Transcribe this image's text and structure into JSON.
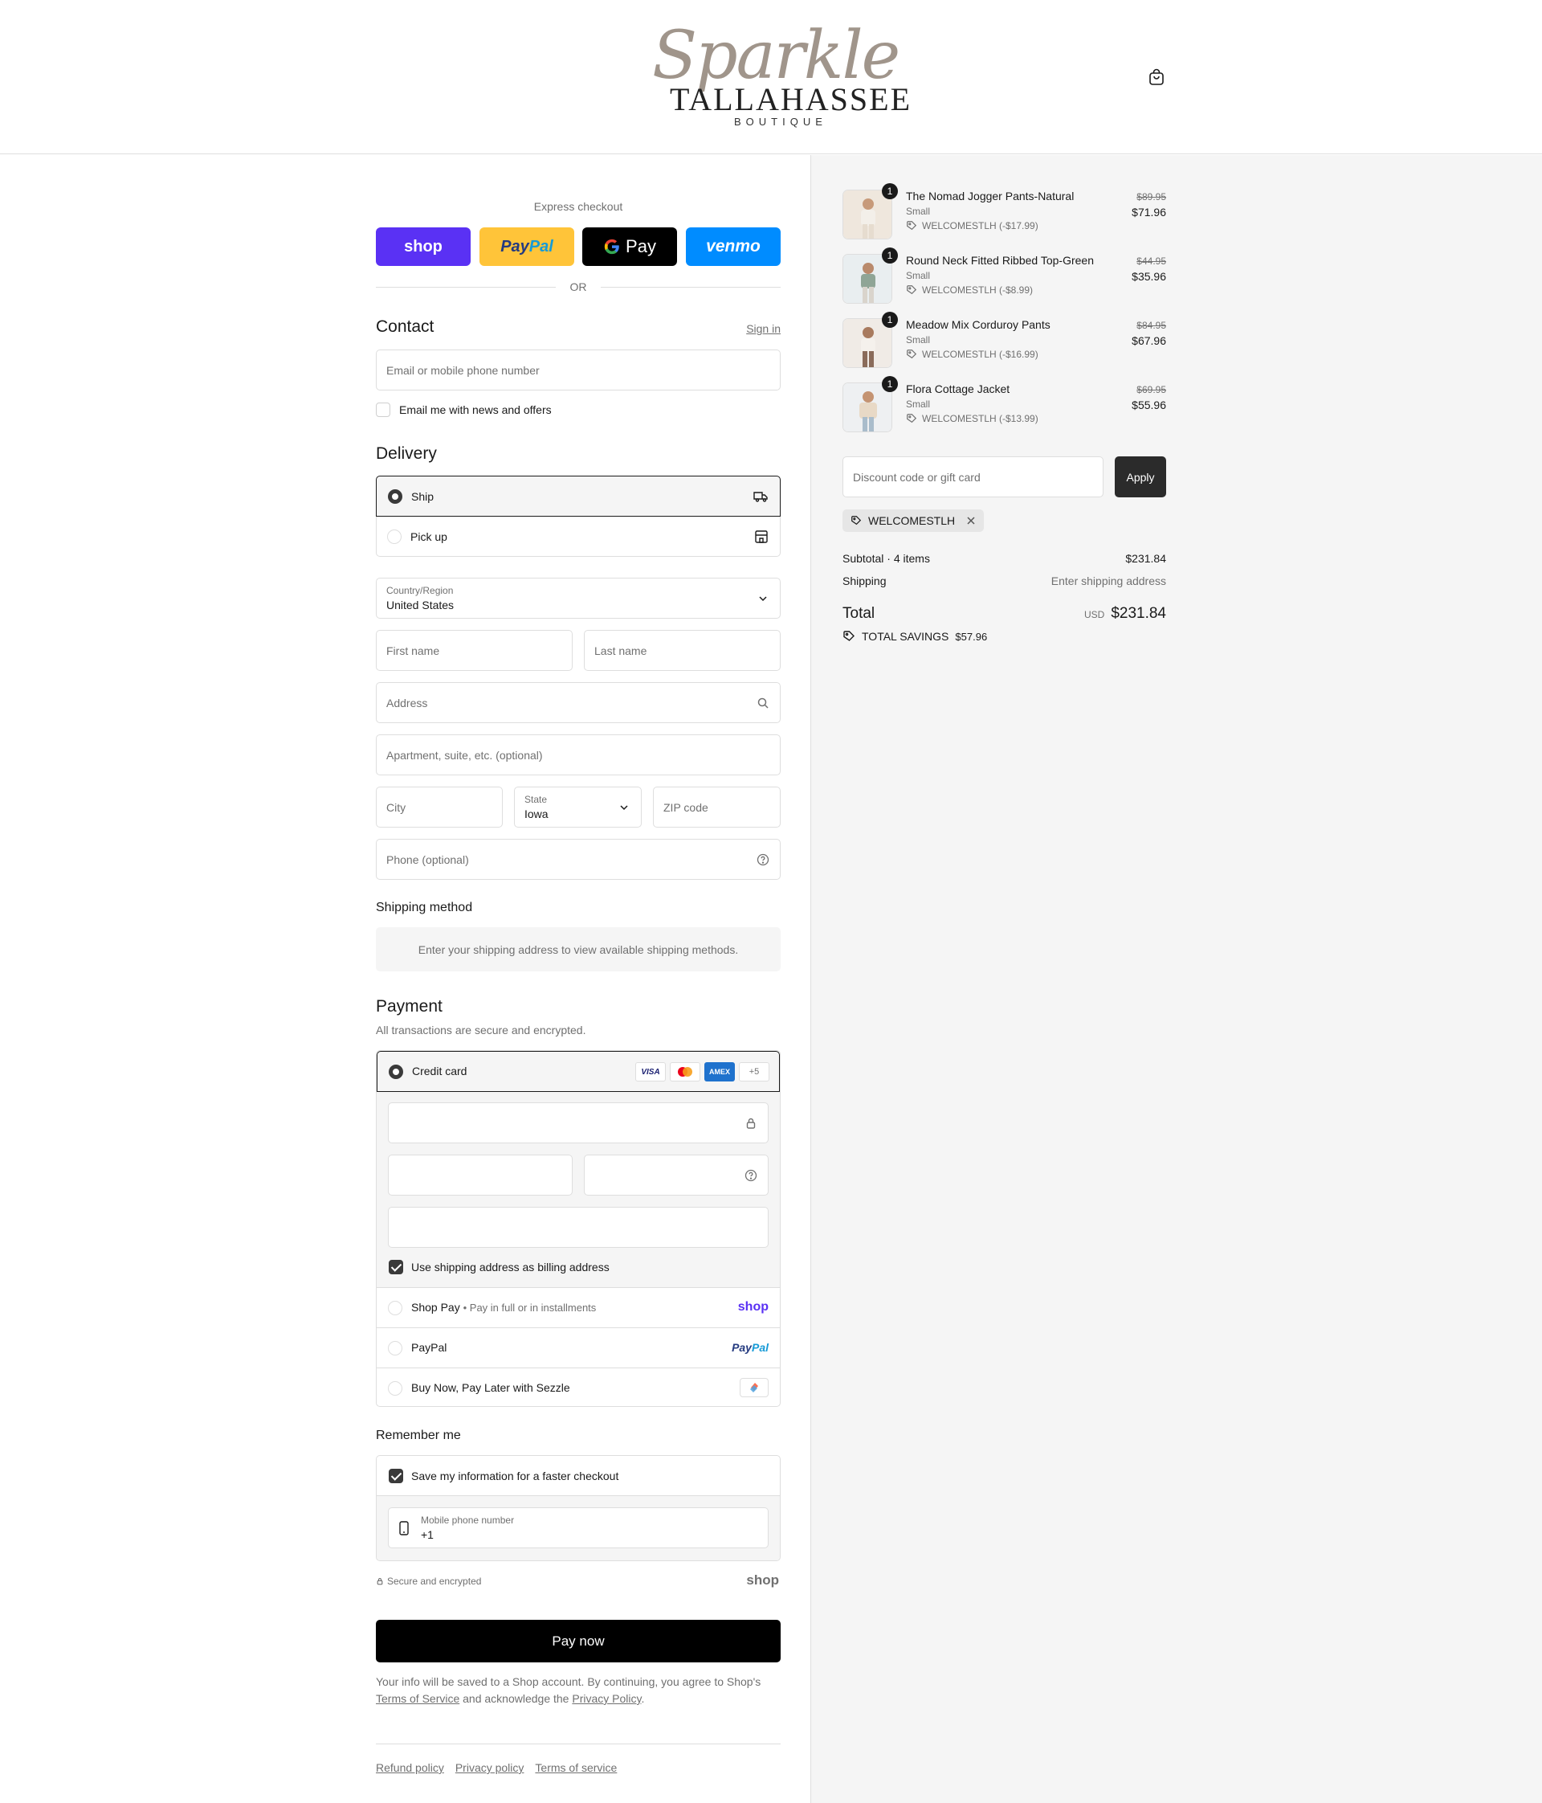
{
  "brand": {
    "script": "Sparkle",
    "main": "TALLAHASSEE",
    "sub": "BOUTIQUE"
  },
  "express": {
    "label": "Express checkout",
    "shop": "shop",
    "paypal_a": "Pay",
    "paypal_b": "Pal",
    "gpay": "Pay",
    "venmo": "venmo",
    "or": "OR"
  },
  "contact": {
    "title": "Contact",
    "sign_in": "Sign in",
    "email_placeholder": "Email or mobile phone number",
    "news_label": "Email me with news and offers"
  },
  "delivery": {
    "title": "Delivery",
    "ship": "Ship",
    "pickup": "Pick up",
    "country_label": "Country/Region",
    "country_value": "United States",
    "first_name": "First name",
    "last_name": "Last name",
    "address": "Address",
    "apartment": "Apartment, suite, etc. (optional)",
    "city": "City",
    "state_label": "State",
    "state_value": "Iowa",
    "zip": "ZIP code",
    "phone": "Phone (optional)"
  },
  "shipping_method": {
    "title": "Shipping method",
    "note": "Enter your shipping address to view available shipping methods."
  },
  "payment": {
    "title": "Payment",
    "subtitle": "All transactions are secure and encrypted.",
    "credit_card": "Credit card",
    "cards": [
      "VISA",
      "",
      "AMEX",
      "+5"
    ],
    "billing_same": "Use shipping address as billing address",
    "shop_pay": "Shop Pay",
    "shop_pay_note": "Pay in full or in installments",
    "shop_logo": "shop",
    "paypal": "PayPal",
    "paypal_logo_a": "Pay",
    "paypal_logo_b": "Pal",
    "sezzle": "Buy Now, Pay Later with Sezzle"
  },
  "remember": {
    "title": "Remember me",
    "save_label": "Save my information for a faster checkout",
    "phone_label": "Mobile phone number",
    "phone_value": "+1",
    "secure": "Secure and encrypted",
    "shop_logo": "shop"
  },
  "pay_now": "Pay now",
  "legal": {
    "text_a": "Your info will be saved to a Shop account. By continuing, you agree to Shop's",
    "terms": "Terms of Service",
    "text_b": "and acknowledge the",
    "privacy": "Privacy Policy",
    "text_c": "."
  },
  "footer": {
    "refund": "Refund policy",
    "privacy": "Privacy policy",
    "terms": "Terms of service"
  },
  "items": [
    {
      "name": "The Nomad Jogger Pants-Natural",
      "variant": "Small",
      "discount": "WELCOMESTLH (-$17.99)",
      "old_price": "$89.95",
      "price": "$71.96",
      "qty": "1"
    },
    {
      "name": "Round Neck Fitted Ribbed Top-Green",
      "variant": "Small",
      "discount": "WELCOMESTLH (-$8.99)",
      "old_price": "$44.95",
      "price": "$35.96",
      "qty": "1"
    },
    {
      "name": "Meadow Mix Corduroy Pants",
      "variant": "Small",
      "discount": "WELCOMESTLH (-$16.99)",
      "old_price": "$84.95",
      "price": "$67.96",
      "qty": "1"
    },
    {
      "name": "Flora Cottage Jacket",
      "variant": "Small",
      "discount": "WELCOMESTLH (-$13.99)",
      "old_price": "$69.95",
      "price": "$55.96",
      "qty": "1"
    }
  ],
  "summary": {
    "discount_placeholder": "Discount code or gift card",
    "apply": "Apply",
    "code_tag": "WELCOMESTLH",
    "subtotal_label": "Subtotal · 4 items",
    "subtotal_value": "$231.84",
    "shipping_label": "Shipping",
    "shipping_value": "Enter shipping address",
    "total_label": "Total",
    "currency": "USD",
    "total_value": "$231.84",
    "savings_label": "TOTAL SAVINGS",
    "savings_value": "$57.96"
  },
  "colors": {
    "shop": "#5a31f4",
    "paypal_yellow": "#ffc439",
    "venmo": "#008cff",
    "dark": "#1a1a1a",
    "apply_btn": "#2b2b2b"
  }
}
